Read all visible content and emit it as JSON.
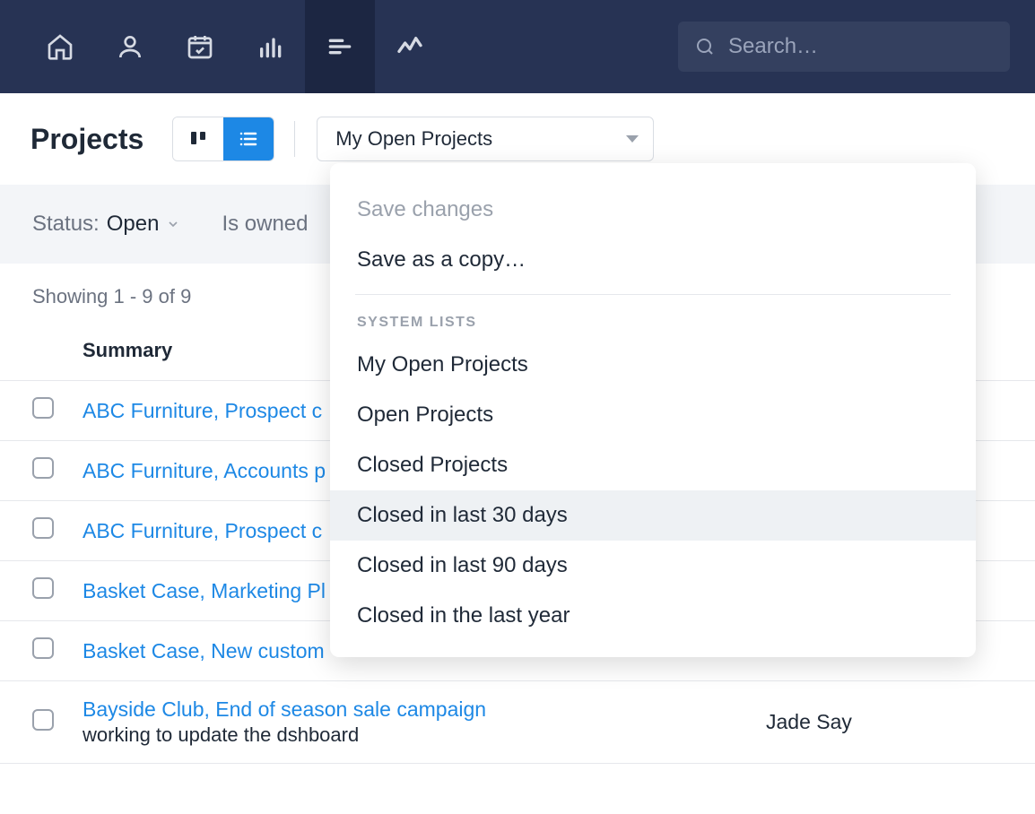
{
  "search": {
    "placeholder": "Search…"
  },
  "page_title": "Projects",
  "select": {
    "value": "My Open Projects"
  },
  "dropdown": {
    "save_changes": "Save changes",
    "save_as_copy": "Save as a copy…",
    "heading": "SYSTEM LISTS",
    "items": [
      "My Open Projects",
      "Open Projects",
      "Closed Projects",
      "Closed in last 30 days",
      "Closed in last 90 days",
      "Closed in the last year"
    ]
  },
  "filters": {
    "status_label": "Status:",
    "status_value": "Open",
    "owned_label": "Is owned"
  },
  "count": "Showing 1 - 9 of 9",
  "columns": {
    "summary": "Summary"
  },
  "rows": [
    {
      "summary": "ABC Furniture, Prospect c",
      "sub": "",
      "owner": ""
    },
    {
      "summary": "ABC Furniture, Accounts p",
      "sub": "",
      "owner": ""
    },
    {
      "summary": "ABC Furniture, Prospect c",
      "sub": "",
      "owner": ""
    },
    {
      "summary": "Basket Case, Marketing Pl",
      "sub": "",
      "owner": ""
    },
    {
      "summary": "Basket Case, New custom",
      "sub": "",
      "owner": ""
    },
    {
      "summary": "Bayside Club, End of season sale campaign",
      "sub": "working to update the dshboard",
      "owner": "Jade Say"
    }
  ]
}
